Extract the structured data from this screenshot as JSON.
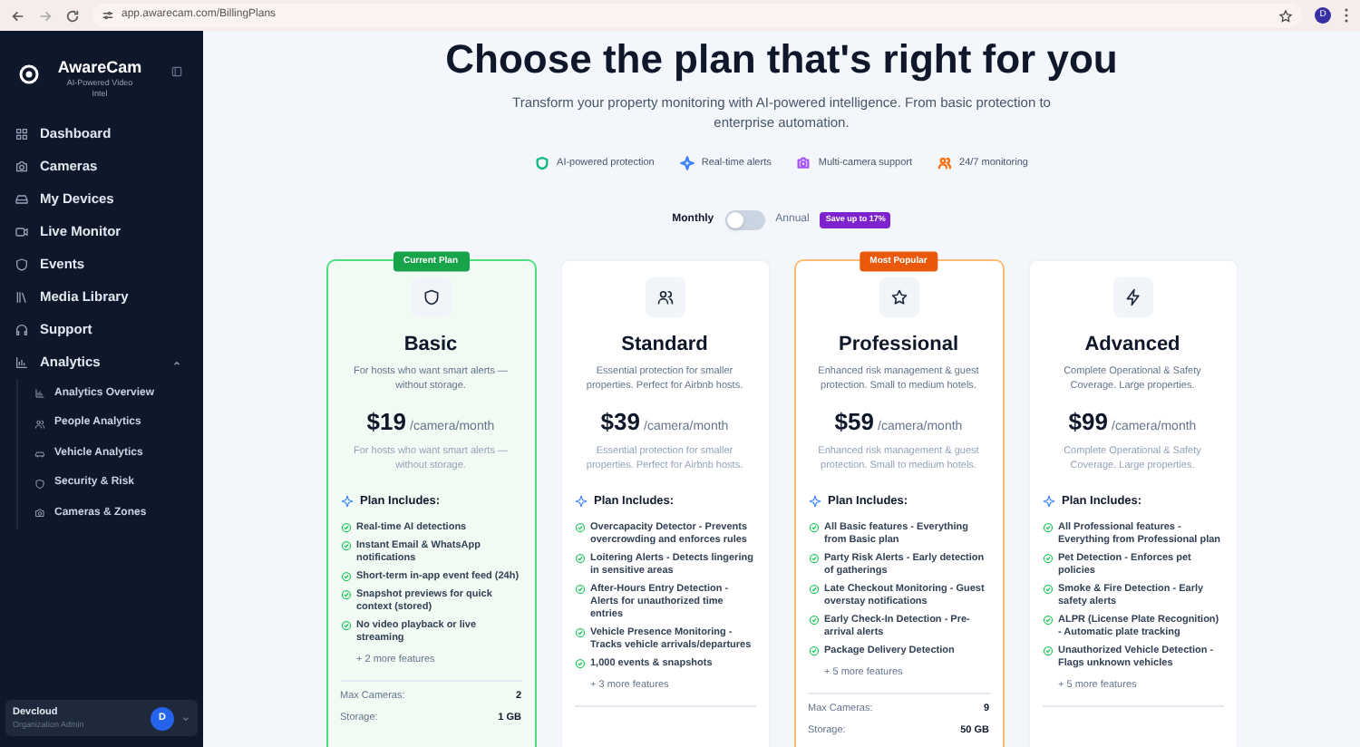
{
  "browser": {
    "url": "app.awarecam.com/BillingPlans",
    "profile_initial": "D"
  },
  "sidebar": {
    "brand": "AwareCam",
    "tagline": "AI-Powered Video Intel",
    "nav": [
      {
        "label": "Dashboard",
        "kind": "dashboard"
      },
      {
        "label": "Cameras",
        "kind": "camera"
      },
      {
        "label": "My Devices",
        "kind": "devices"
      },
      {
        "label": "Live Monitor",
        "kind": "video"
      },
      {
        "label": "Events",
        "kind": "shield"
      },
      {
        "label": "Media Library",
        "kind": "library"
      },
      {
        "label": "Support",
        "kind": "support"
      },
      {
        "label": "Analytics",
        "kind": "chart",
        "expanded": true,
        "children": [
          {
            "label": "Analytics Overview",
            "kind": "chart"
          },
          {
            "label": "People Analytics",
            "kind": "users"
          },
          {
            "label": "Vehicle Analytics",
            "kind": "car"
          },
          {
            "label": "Security & Risk",
            "kind": "shield"
          },
          {
            "label": "Cameras & Zones",
            "kind": "camera"
          }
        ]
      }
    ],
    "user": {
      "name": "Devcloud",
      "role": "Organization Admin",
      "initial": "D"
    }
  },
  "page": {
    "title": "Choose the plan that's right for you",
    "subtitle": "Transform your property monitoring with AI-powered intelligence. From basic protection to enterprise automation.",
    "highlights": [
      {
        "label": "AI-powered protection",
        "kind": "shield",
        "color": "#10b981"
      },
      {
        "label": "Real-time alerts",
        "kind": "sparkle",
        "color": "#3b82f6"
      },
      {
        "label": "Multi-camera support",
        "kind": "camera",
        "color": "#a855f7"
      },
      {
        "label": "24/7 monitoring",
        "kind": "users",
        "color": "#f97316"
      }
    ]
  },
  "billing": {
    "monthly_label": "Monthly",
    "annual_label": "Annual",
    "annual": false,
    "badge": "Save up to 17%"
  },
  "plans": [
    {
      "name": "Basic",
      "badge": "Current Plan",
      "current": true,
      "popular": false,
      "kind": "shield",
      "description": "For hosts who want smart alerts — without storage.",
      "price": "$19",
      "unit": "/camera/month",
      "note": "For hosts who want smart alerts — without storage.",
      "includes_label": "Plan Includes:",
      "features": [
        "Real-time AI detections",
        "Instant Email & WhatsApp notifications",
        "Short-term in-app event feed (24h)",
        "Snapshot previews for quick context (stored)",
        "No video playback or live streaming"
      ],
      "more": "+ 2 more features",
      "limits": [
        {
          "label": "Max Cameras:",
          "value": "2"
        },
        {
          "label": "Storage:",
          "value": "1 GB"
        }
      ]
    },
    {
      "name": "Standard",
      "current": false,
      "popular": false,
      "kind": "users",
      "description": "Essential protection for smaller properties. Perfect for Airbnb hosts.",
      "price": "$39",
      "unit": "/camera/month",
      "note": "Essential protection for smaller properties. Perfect for Airbnb hosts.",
      "includes_label": "Plan Includes:",
      "features": [
        "Overcapacity Detector - Prevents overcrowding and enforces rules",
        "Loitering Alerts - Detects lingering in sensitive areas",
        "After-Hours Entry Detection - Alerts for unauthorized time entries",
        "Vehicle Presence Monitoring - Tracks vehicle arrivals/departures",
        "1,000 events & snapshots"
      ],
      "more": "+ 3 more features"
    },
    {
      "name": "Professional",
      "badge": "Most Popular",
      "current": false,
      "popular": true,
      "kind": "star",
      "description": "Enhanced risk management & guest protection. Small to medium hotels.",
      "price": "$59",
      "unit": "/camera/month",
      "note": "Enhanced risk management & guest protection. Small to medium hotels.",
      "includes_label": "Plan Includes:",
      "features": [
        "All Basic features - Everything from Basic plan",
        "Party Risk Alerts - Early detection of gatherings",
        "Late Checkout Monitoring - Guest overstay notifications",
        "Early Check-In Detection - Pre-arrival alerts",
        "Package Delivery Detection"
      ],
      "more": "+ 5 more features",
      "limits": [
        {
          "label": "Max Cameras:",
          "value": "9"
        },
        {
          "label": "Storage:",
          "value": "50 GB"
        }
      ]
    },
    {
      "name": "Advanced",
      "current": false,
      "popular": false,
      "kind": "bolt",
      "description": "Complete Operational & Safety Coverage. Large properties.",
      "price": "$99",
      "unit": "/camera/month",
      "note": "Complete Operational & Safety Coverage. Large properties.",
      "includes_label": "Plan Includes:",
      "features": [
        "All Professional features - Everything from Professional plan",
        "Pet Detection - Enforces pet policies",
        "Smoke & Fire Detection - Early safety alerts",
        "ALPR (License Plate Recognition) - Automatic plate tracking",
        "Unauthorized Vehicle Detection - Flags unknown vehicles"
      ],
      "more": "+ 5 more features"
    }
  ]
}
